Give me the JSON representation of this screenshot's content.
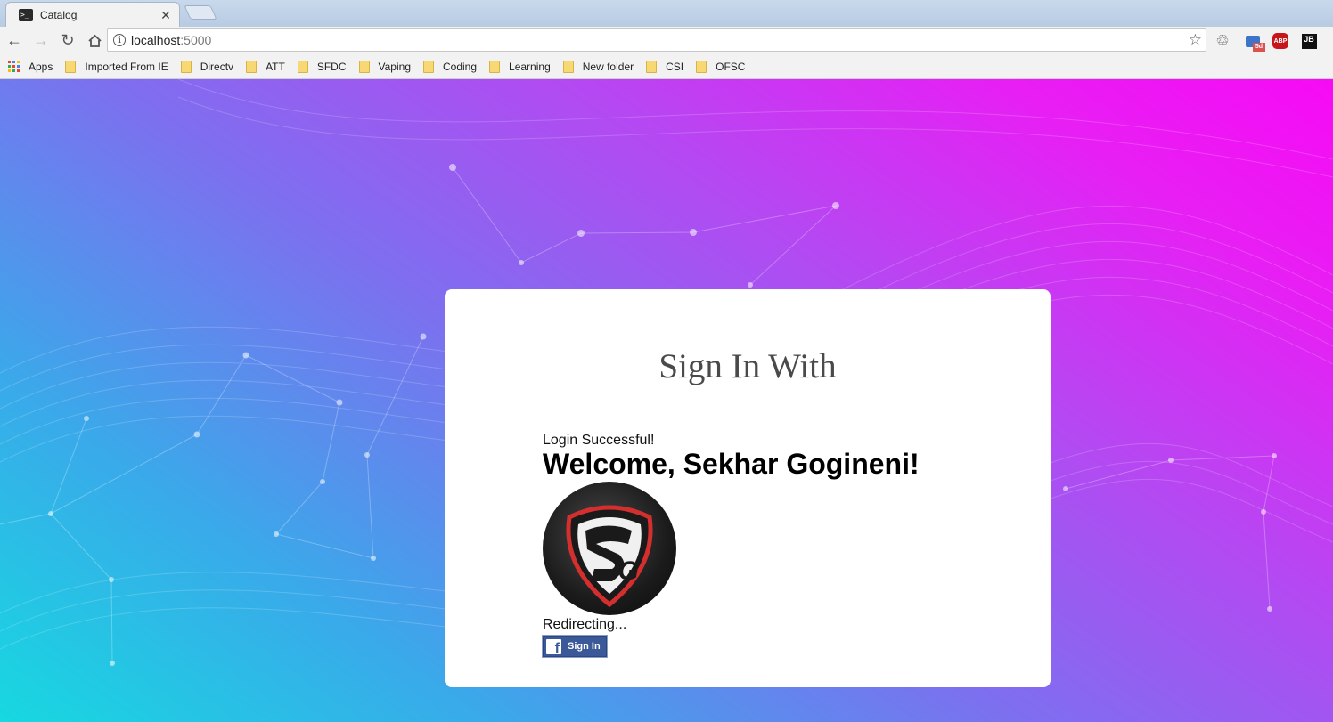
{
  "browser": {
    "tab_title": "Catalog",
    "url_host": "localhost",
    "url_port": ":5000",
    "bookmarks": [
      "Apps",
      "Imported From IE",
      "Directv",
      "ATT",
      "SFDC",
      "Vaping",
      "Coding",
      "Learning",
      "New folder",
      "CSI",
      "OFSC"
    ],
    "extensions": [
      "recycle-icon",
      "sd-icon",
      "abp-icon",
      "jb-icon"
    ],
    "ext_labels": {
      "sd": "5d",
      "abp": "ABP",
      "jb": "JB"
    }
  },
  "page": {
    "card_title": "Sign In With",
    "status": "Login Successful!",
    "welcome": "Welcome, Sekhar Gogineni!",
    "avatar_text": "SG",
    "redirect": "Redirecting...",
    "fb_button": "Sign In",
    "fb_glyph": "f"
  },
  "colors": {
    "gradient_start": "#17d8e0",
    "gradient_end": "#f70af5",
    "facebook": "#3b5998",
    "avatar_accent": "#d32f2f"
  }
}
